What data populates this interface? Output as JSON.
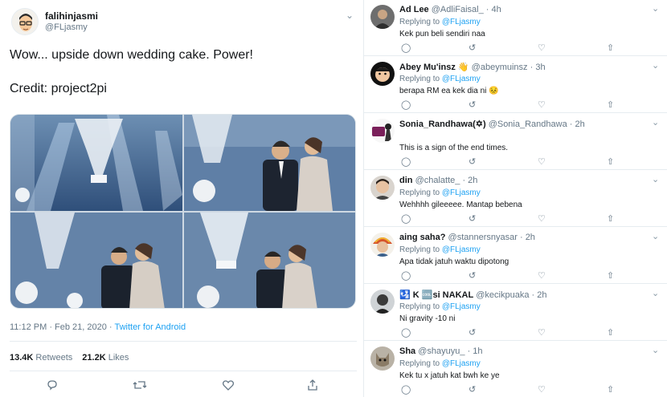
{
  "tweet": {
    "display_name": "falihinjasmi",
    "handle": "@FLjasmy",
    "text": "Wow... upside down wedding cake. Power!",
    "credit": "Credit: project2pi",
    "timestamp": "11:12 PM · Feb 21, 2020 · ",
    "source": "Twitter for Android",
    "retweets_count": "13.4K",
    "retweets_label": "Retweets",
    "likes_count": "21.2K",
    "likes_label": "Likes",
    "icons": [
      "reply-icon",
      "retweet-icon",
      "like-icon",
      "share-icon",
      "chevron-down-icon"
    ]
  },
  "replies": [
    {
      "name": "Ad Lee",
      "handle": "@AdliFaisal_",
      "time": "· 4h",
      "replying_prefix": "Replying to ",
      "replying_to": "@FLjasmy",
      "text": "Kek pun beli sendiri naa"
    },
    {
      "name": "Abey Mu'insz 👋",
      "handle": "@abeymuinsz",
      "time": "· 3h",
      "replying_prefix": "Replying to ",
      "replying_to": "@FLjasmy",
      "text": "berapa RM ea kek dia ni 😣"
    },
    {
      "name": "Sonia_Randhawa(✡)",
      "handle": "@Sonia_Randhawa",
      "time": "· 2h",
      "replying_prefix": "",
      "replying_to": "",
      "text": "This is a sign of the end times."
    },
    {
      "name": "din",
      "handle": "@chalatte_",
      "time": "· 2h",
      "replying_prefix": "Replying to ",
      "replying_to": "@FLjasmy",
      "text": "Wehhhh gileeeee. Mantap bebena"
    },
    {
      "name": "aing saha?",
      "handle": "@stannersnyasar",
      "time": "· 2h",
      "replying_prefix": "Replying to ",
      "replying_to": "@FLjasmy",
      "text": "Apa tidak jatuh waktu dipotong"
    },
    {
      "name": "🛂 K 🆒si NAKAL",
      "handle": "@kecikpuaka",
      "time": "· 2h",
      "replying_prefix": "Replying to ",
      "replying_to": "@FLjasmy",
      "text": "Ni gravity -10 ni"
    },
    {
      "name": "Sha",
      "handle": "@shayuyu_",
      "time": "· 1h",
      "replying_prefix": "Replying to ",
      "replying_to": "@FLjasmy",
      "text": "Kek tu x jatuh kat bwh ke ye"
    }
  ],
  "colors": {
    "link": "#1da1f2",
    "secondary": "#657786",
    "border": "#e6ecf0"
  }
}
